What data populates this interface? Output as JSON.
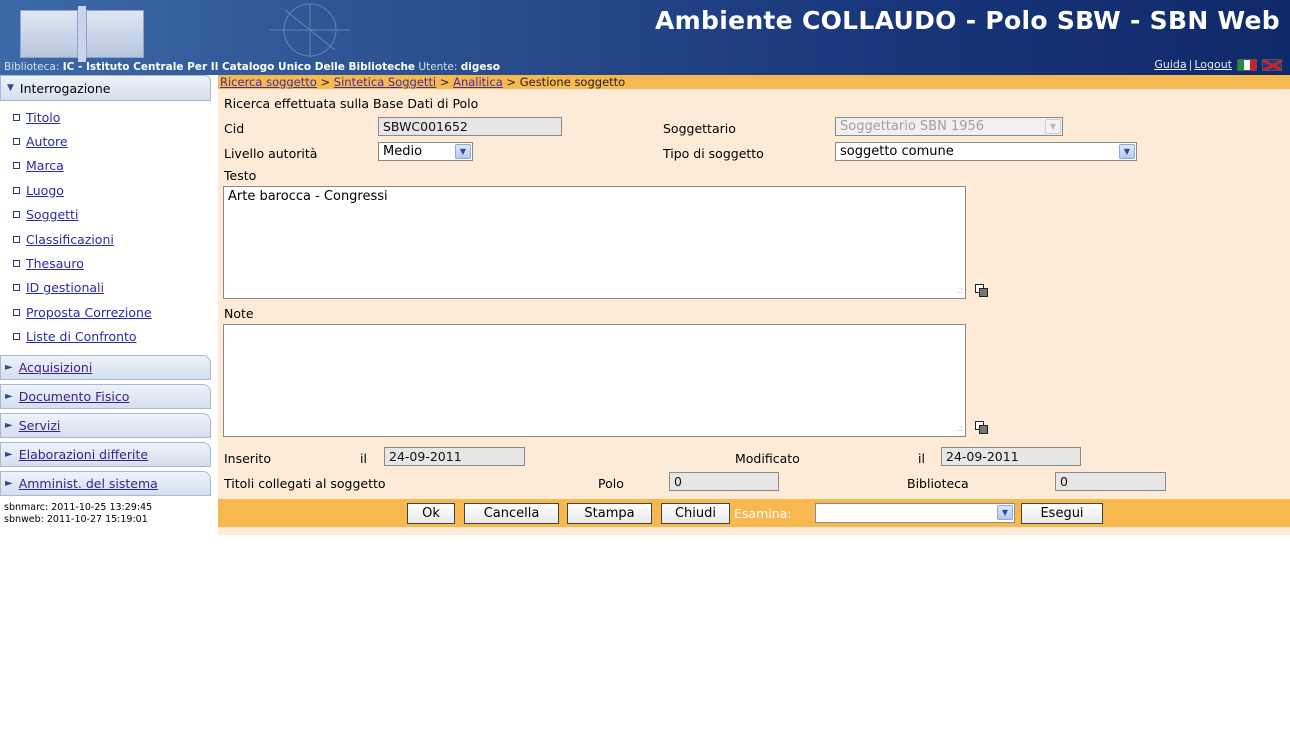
{
  "header": {
    "title": "Ambiente COLLAUDO - Polo SBW - SBN Web",
    "biblioteca_label": "Biblioteca:",
    "biblioteca_code": "IC",
    "biblioteca_name": " - Istituto Centrale Per Il Catalogo Unico Delle Biblioteche",
    "utente_label": "Utente:",
    "utente_value": "digeso",
    "guida": "Guida",
    "separator": "|",
    "logout": "Logout"
  },
  "sidebar": {
    "interrogazione": "Interrogazione",
    "items": [
      "Titolo",
      "Autore",
      "Marca",
      "Luogo",
      "Soggetti",
      "Classificazioni",
      "Thesauro",
      "ID gestionali",
      "Proposta Correzione",
      "Liste di Confronto"
    ],
    "sections": [
      "Acquisizioni",
      "Documento Fisico",
      "Servizi",
      "Elaborazioni differite",
      "Amminist. del sistema"
    ],
    "timestamps": [
      "sbnmarc: 2011-10-25 13:29:45",
      "sbnweb:  2011-10-27 15:19:01"
    ]
  },
  "breadcrumb": {
    "links": [
      "Ricerca soggetto",
      "Sintetica Soggetti",
      "Analitica"
    ],
    "sep": " > ",
    "current": "Gestione soggetto"
  },
  "form": {
    "ricerca_note": "Ricerca effettuata sulla Base Dati di Polo",
    "cid_label": "Cid",
    "cid_value": "SBWC001652",
    "soggettario_label": "Soggettario",
    "soggettario_value": "Soggettario SBN 1956",
    "livello_label": "Livello autorità",
    "livello_value": "Medio",
    "tipo_label": "Tipo di soggetto",
    "tipo_value": "soggetto comune",
    "testo_label": "Testo",
    "testo_value": "Arte barocca - Congressi",
    "note_label": "Note",
    "note_value": "",
    "inserito_label": "Inserito",
    "inserito_il": "il",
    "inserito_value": "24-09-2011",
    "modificato_label": "Modificato",
    "modificato_il": "il",
    "modificato_value": "24-09-2011",
    "titoli_label": "Titoli collegati al soggetto",
    "polo_label": "Polo",
    "polo_value": "0",
    "biblioteca_label": "Biblioteca",
    "biblioteca_value": "0"
  },
  "toolbar": {
    "ok": "Ok",
    "cancella": "Cancella",
    "stampa": "Stampa",
    "chiudi": "Chiudi",
    "esamina_label": "Esamina:",
    "esamina_value": "",
    "esegui": "Esegui"
  },
  "colors": {
    "toolbar_bg": "#f7b84f",
    "form_bg": "#fdebd7",
    "header_bg": "#18357a"
  }
}
